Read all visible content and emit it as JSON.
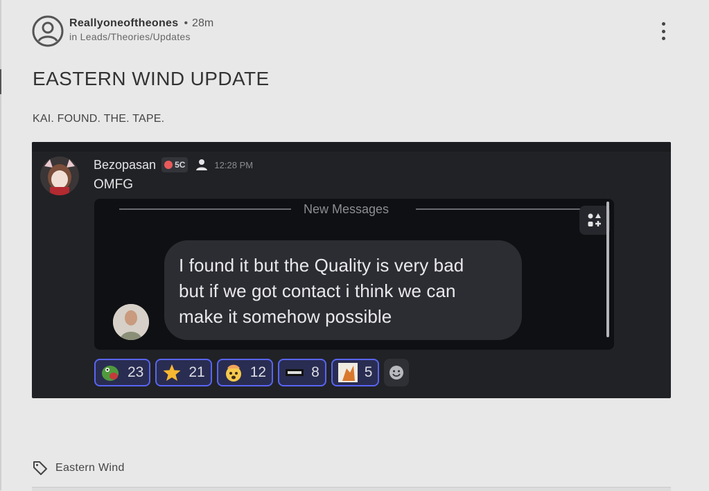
{
  "post": {
    "author": "Reallyoneoftheones",
    "separator": "•",
    "time_ago": "28m",
    "category": "in Leads/Theories/Updates",
    "title": "EASTERN WIND UPDATE",
    "body": "KAI. FOUND. THE. TAPE.",
    "tag": "Eastern Wind"
  },
  "embedded_screenshot": {
    "username": "Bezopasan",
    "server_tag": "5C",
    "timestamp": "12:28 PM",
    "message": "OMFG",
    "new_messages_label": "New Messages",
    "bubble_lines": [
      "I found it but the Quality is very bad",
      "but if we got contact i think we can",
      "make it somehow possible"
    ],
    "reactions": [
      {
        "emoji": "pepe-icon",
        "count": "23"
      },
      {
        "emoji": "star-icon",
        "count": "21"
      },
      {
        "emoji": "mind-blown-icon",
        "count": "12"
      },
      {
        "emoji": "custom-badge-icon",
        "count": "8"
      },
      {
        "emoji": "cat-icon",
        "count": "5"
      }
    ]
  }
}
